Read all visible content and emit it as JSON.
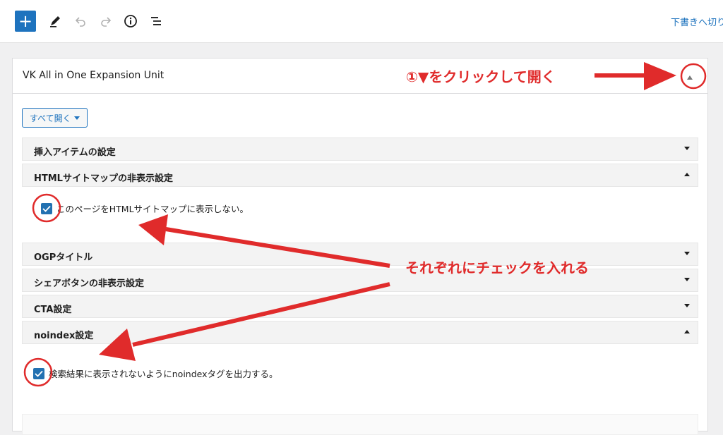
{
  "toolbar": {
    "add_label": "+",
    "right_text": "下書きへ切り"
  },
  "panel": {
    "title": "VK All in One Expansion Unit",
    "open_all_label": "すべて開く",
    "sections": [
      {
        "label": "挿入アイテムの設定",
        "state": "collapsed"
      },
      {
        "label": "HTMLサイトマップの非表示設定",
        "state": "expanded"
      },
      {
        "label": "OGPタイトル",
        "state": "collapsed"
      },
      {
        "label": "シェアボタンの非表示設定",
        "state": "collapsed"
      },
      {
        "label": "CTA設定",
        "state": "collapsed"
      },
      {
        "label": "noindex設定",
        "state": "expanded"
      }
    ],
    "checkbox_sitemap": {
      "label": "このページをHTMLサイトマップに表示しない。",
      "checked": true
    },
    "checkbox_noindex": {
      "label": "検索結果に表示されないようにnoindexタグを出力する。",
      "checked": true
    }
  },
  "annotations": {
    "step1": "①▼をクリックして開く",
    "check_each": "それぞれにチェックを入れる"
  },
  "colors": {
    "accent": "#1e73be",
    "annotation": "#e02b2b"
  }
}
